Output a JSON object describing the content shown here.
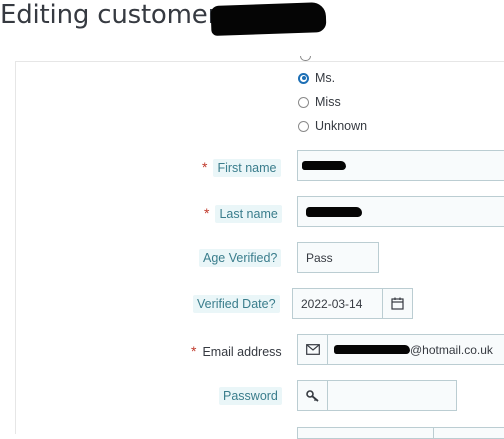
{
  "header": {
    "title": "Editing customer"
  },
  "gender": {
    "options": [
      {
        "label": "Ms.",
        "checked": true
      },
      {
        "label": "Miss",
        "checked": false
      },
      {
        "label": "Unknown",
        "checked": false
      }
    ]
  },
  "form": {
    "first_name": {
      "label": "First name",
      "required": "*"
    },
    "last_name": {
      "label": "Last name",
      "required": "*"
    },
    "age_verified": {
      "label": "Age Verified?",
      "value": "Pass"
    },
    "verified_date": {
      "label": "Verified Date?",
      "value": "2022-03-14"
    },
    "email": {
      "label": "Email address",
      "required": "*",
      "value_suffix": "@hotmail.co.uk"
    },
    "password": {
      "label": "Password"
    }
  },
  "icons": {
    "calendar": "calendar-icon",
    "envelope": "envelope-icon",
    "key": "key-icon"
  },
  "colors": {
    "label_text": "#3a7d8c",
    "label_chip_bg": "#eaf6f8",
    "required": "#c0392b",
    "radio_checked": "#1d6fb5",
    "field_border": "#bbcdd2",
    "field_bg": "#f8fbfc"
  }
}
